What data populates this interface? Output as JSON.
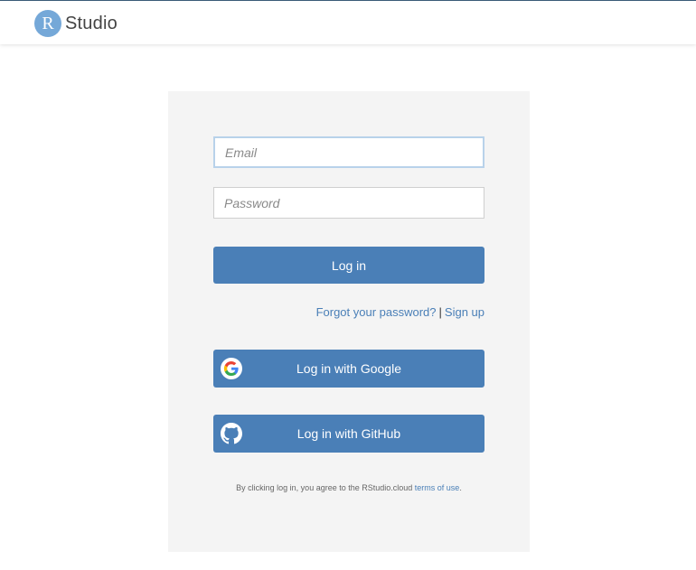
{
  "header": {
    "logo_letter": "R",
    "logo_text": "Studio"
  },
  "login": {
    "email_placeholder": "Email",
    "email_value": "",
    "password_placeholder": "Password",
    "password_value": "",
    "login_label": "Log in",
    "forgot_label": "Forgot your password?",
    "separator": "|",
    "signup_label": "Sign up",
    "google_label": "Log in with Google",
    "github_label": "Log in with GitHub",
    "terms_text": "By clicking log in, you agree to the RStudio.cloud",
    "terms_link": "terms of use",
    "terms_end": "."
  },
  "icons": {
    "google": "google-icon",
    "github": "github-icon"
  },
  "colors": {
    "accent": "#4a7fb7",
    "logo_circle": "#75a8d8",
    "panel_bg": "#f4f4f4"
  }
}
